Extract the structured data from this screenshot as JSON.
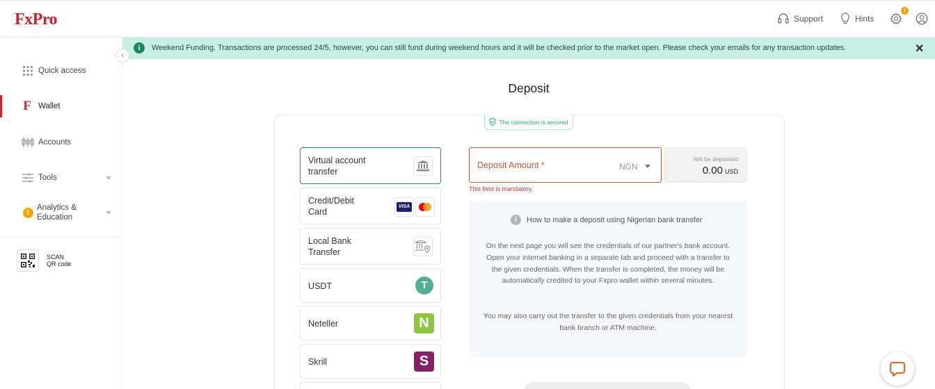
{
  "header": {
    "logo": "FxPro",
    "support_label": "Support",
    "hints_label": "Hints",
    "settings_badge": "!"
  },
  "sidebar": {
    "items": [
      {
        "label": "Quick access",
        "icon": "grid-icon"
      },
      {
        "label": "Wallet",
        "icon": "fxpro-f-icon"
      },
      {
        "label": "Accounts",
        "icon": "candlestick-icon"
      },
      {
        "label": "Tools",
        "icon": "sliders-icon"
      },
      {
        "label_line1": "Analytics &",
        "label_line2": "Education",
        "icon": "info-circle-icon"
      }
    ],
    "scan_line1": "SCAN",
    "scan_line2": "QR code",
    "collapse_glyph": "‹"
  },
  "banner": {
    "text": "Weekend Funding. Transactions are processed 24/5, however, you can still fund during weekend hours and it will be checked prior to the market open. Please check your emails for any transaction updates.",
    "info_glyph": "i",
    "close_glyph": "✕"
  },
  "deposit": {
    "title": "Deposit",
    "secure_text": "The connection is secured",
    "methods": [
      {
        "line1": "Virtual account",
        "line2": "transfer",
        "icon": "bank-icon",
        "selected": true
      },
      {
        "line1": "Credit/Debit",
        "line2": "Card",
        "icon": "visa-mastercard-icon"
      },
      {
        "line1": "Local Bank",
        "line2": "Transfer",
        "icon": "bank-location-icon"
      },
      {
        "line1": "USDT",
        "icon": "tether-icon"
      },
      {
        "line1": "Neteller",
        "icon": "neteller-icon"
      },
      {
        "line1": "Skrill",
        "icon": "skrill-icon"
      }
    ],
    "visa_text": "VISA",
    "amount_label": "Deposit Amount *",
    "currency": "NGN",
    "error_text": "This field is mandatory.",
    "will_be_label": "Will be deposited",
    "will_be_value": "0.00",
    "will_be_currency": "USD",
    "howto_title": "How to make a deposit using Nigerian bank transfer",
    "howto_p1": "On the next page you will see the credentials of our partner's bank account. Open your internet banking in a separate tab and proceed with a transfer to the given credentials. When the transfer is completed, the money will be automatically credited to your Fxpro wallet within several minutes.",
    "howto_p2": "You may also carry out the transfer to the given credentials from your nearest bank branch or ATM machine.",
    "neteller_letter": "N",
    "skrill_letter": "S",
    "tether_letter": "T"
  },
  "colors": {
    "brand_red": "#d3202a",
    "banner_bg": "#c9eee6",
    "selected_border": "#2e8b57",
    "neteller_green": "#8dc63f",
    "skrill_purple": "#862165",
    "tether_green": "#50af95"
  }
}
